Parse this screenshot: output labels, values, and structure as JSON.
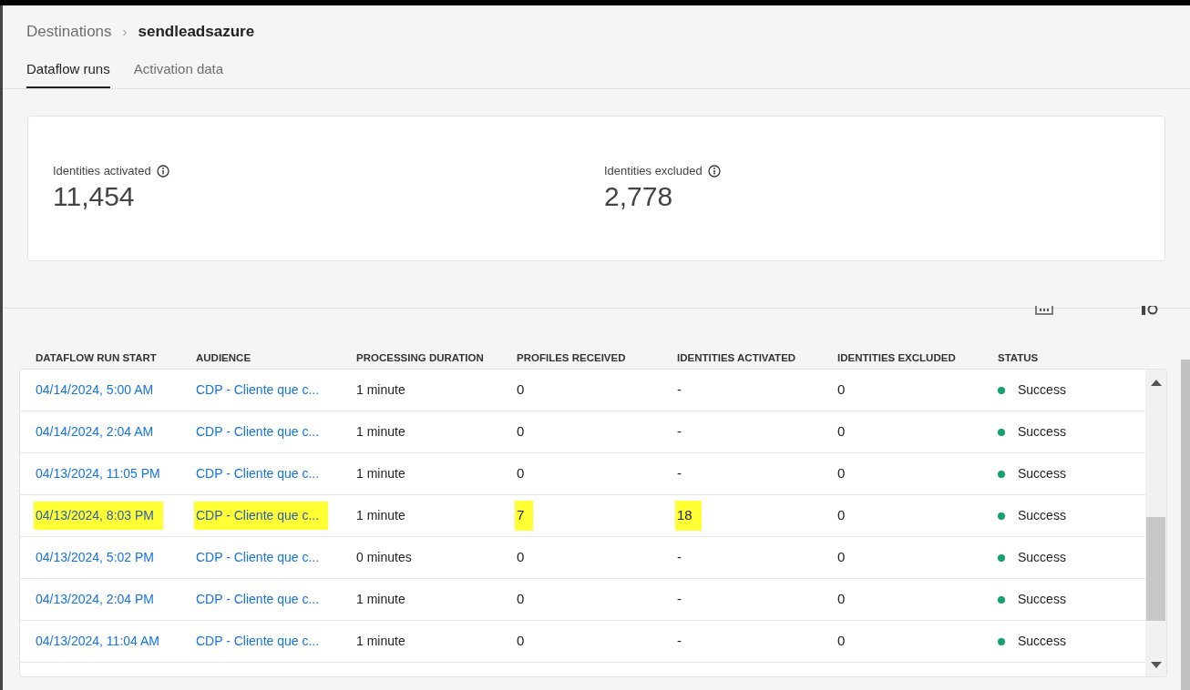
{
  "breadcrumb": {
    "parent": "Destinations",
    "separator": "›",
    "current": "sendleadsazure"
  },
  "tabs": [
    {
      "label": "Dataflow runs",
      "selected": true
    },
    {
      "label": "Activation data",
      "selected": false
    }
  ],
  "metrics": [
    {
      "label": "Identities activated",
      "value": "11,454"
    },
    {
      "label": "Identities excluded",
      "value": "2,778"
    }
  ],
  "table": {
    "columns": [
      "DATAFLOW RUN START",
      "AUDIENCE",
      "PROCESSING DURATION",
      "PROFILES RECEIVED",
      "IDENTITIES ACTIVATED",
      "IDENTITIES EXCLUDED",
      "STATUS"
    ],
    "rows": [
      {
        "cells": [
          {
            "text": "04/14/2024, 5:00 AM",
            "highlighted": false
          },
          {
            "text": "CDP - Cliente que c...",
            "highlighted": false
          },
          {
            "text": "1 minute",
            "highlighted": false
          },
          {
            "text": "0",
            "highlighted": false
          },
          {
            "text": "-",
            "highlighted": false
          },
          {
            "text": "0",
            "highlighted": false
          }
        ],
        "status": {
          "text": "Success",
          "color": "#12a26c"
        }
      },
      {
        "cells": [
          {
            "text": "04/14/2024, 2:04 AM",
            "highlighted": false
          },
          {
            "text": "CDP - Cliente que c...",
            "highlighted": false
          },
          {
            "text": "1 minute",
            "highlighted": false
          },
          {
            "text": "0",
            "highlighted": false
          },
          {
            "text": "-",
            "highlighted": false
          },
          {
            "text": "0",
            "highlighted": false
          }
        ],
        "status": {
          "text": "Success",
          "color": "#12a26c"
        }
      },
      {
        "cells": [
          {
            "text": "04/13/2024, 11:05 PM",
            "highlighted": false
          },
          {
            "text": "CDP - Cliente que c...",
            "highlighted": false
          },
          {
            "text": "1 minute",
            "highlighted": false
          },
          {
            "text": "0",
            "highlighted": false
          },
          {
            "text": "-",
            "highlighted": false
          },
          {
            "text": "0",
            "highlighted": false
          }
        ],
        "status": {
          "text": "Success",
          "color": "#12a26c"
        }
      },
      {
        "cells": [
          {
            "text": "04/13/2024, 8:03 PM",
            "highlighted": true
          },
          {
            "text": "CDP - Cliente que c...",
            "highlighted": true
          },
          {
            "text": "1 minute",
            "highlighted": false
          },
          {
            "text": "7",
            "highlighted": true
          },
          {
            "text": "18",
            "highlighted": true
          },
          {
            "text": "0",
            "highlighted": false
          }
        ],
        "status": {
          "text": "Success",
          "color": "#12a26c"
        }
      },
      {
        "cells": [
          {
            "text": "04/13/2024, 5:02 PM",
            "highlighted": false
          },
          {
            "text": "CDP - Cliente que c...",
            "highlighted": false
          },
          {
            "text": "0 minutes",
            "highlighted": false
          },
          {
            "text": "0",
            "highlighted": false
          },
          {
            "text": "-",
            "highlighted": false
          },
          {
            "text": "0",
            "highlighted": false
          }
        ],
        "status": {
          "text": "Success",
          "color": "#12a26c"
        }
      },
      {
        "cells": [
          {
            "text": "04/13/2024, 2:04 PM",
            "highlighted": false
          },
          {
            "text": "CDP - Cliente que c...",
            "highlighted": false
          },
          {
            "text": "1 minute",
            "highlighted": false
          },
          {
            "text": "0",
            "highlighted": false
          },
          {
            "text": "-",
            "highlighted": false
          },
          {
            "text": "0",
            "highlighted": false
          }
        ],
        "status": {
          "text": "Success",
          "color": "#12a26c"
        }
      },
      {
        "cells": [
          {
            "text": "04/13/2024, 11:04 AM",
            "highlighted": false
          },
          {
            "text": "CDP - Cliente que c...",
            "highlighted": false
          },
          {
            "text": "1 minute",
            "highlighted": false
          },
          {
            "text": "0",
            "highlighted": false
          },
          {
            "text": "-",
            "highlighted": false
          },
          {
            "text": "0",
            "highlighted": false
          }
        ],
        "status": {
          "text": "Success",
          "color": "#12a26c"
        }
      }
    ]
  }
}
